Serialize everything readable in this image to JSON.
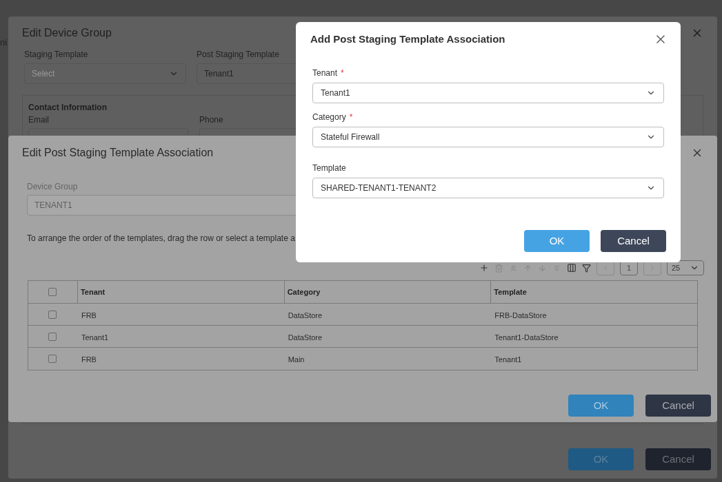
{
  "background": {
    "fragment": "ni"
  },
  "edit_device_group": {
    "title": "Edit Device Group",
    "fields": [
      {
        "label": "Staging Template",
        "placeholder": "Select",
        "kind": "select"
      },
      {
        "label": "Post Staging Template",
        "value": "Tenant1",
        "kind": "input"
      }
    ],
    "contact": {
      "title": "Contact Information",
      "fields": [
        {
          "label": "Email"
        },
        {
          "label": "Phone"
        }
      ]
    },
    "buttons": [
      {
        "label": "OK",
        "kind": "primary"
      },
      {
        "label": "Cancel",
        "kind": "secondary"
      }
    ]
  },
  "edit_association": {
    "title": "Edit Post Staging Template Association",
    "device_group": {
      "label": "Device Group",
      "value": "TENANT1",
      "disabled": true
    },
    "instructions": "To arrange the order of the templates, drag the row or select a template a",
    "toolbar": {
      "page": "1",
      "page_size": "25"
    },
    "table": {
      "columns": [
        "Tenant",
        "Category",
        "Template"
      ],
      "header_checked": false,
      "rows": [
        {
          "cells": [
            "FRB",
            "DataStore",
            "FRB-DataStore"
          ],
          "checked": false
        },
        {
          "cells": [
            "Tenant1",
            "DataStore",
            "Tenant1-DataStore"
          ],
          "checked": false
        },
        {
          "cells": [
            "FRB",
            "Main",
            "Tenant1"
          ],
          "checked": false
        }
      ]
    },
    "buttons": [
      {
        "label": "OK",
        "kind": "primary"
      },
      {
        "label": "Cancel",
        "kind": "secondary"
      }
    ]
  },
  "add_association": {
    "title": "Add Post Staging Template Association",
    "fields": [
      {
        "label": "Tenant",
        "required_mark": "*",
        "value": "Tenant1"
      },
      {
        "label": "Category",
        "required_mark": "*",
        "value": "Stateful Firewall"
      },
      {
        "label": "Template",
        "value": "SHARED-TENANT1-TENANT2"
      }
    ],
    "buttons": [
      {
        "label": "OK",
        "kind": "primary"
      },
      {
        "label": "Cancel",
        "kind": "secondary"
      }
    ]
  }
}
